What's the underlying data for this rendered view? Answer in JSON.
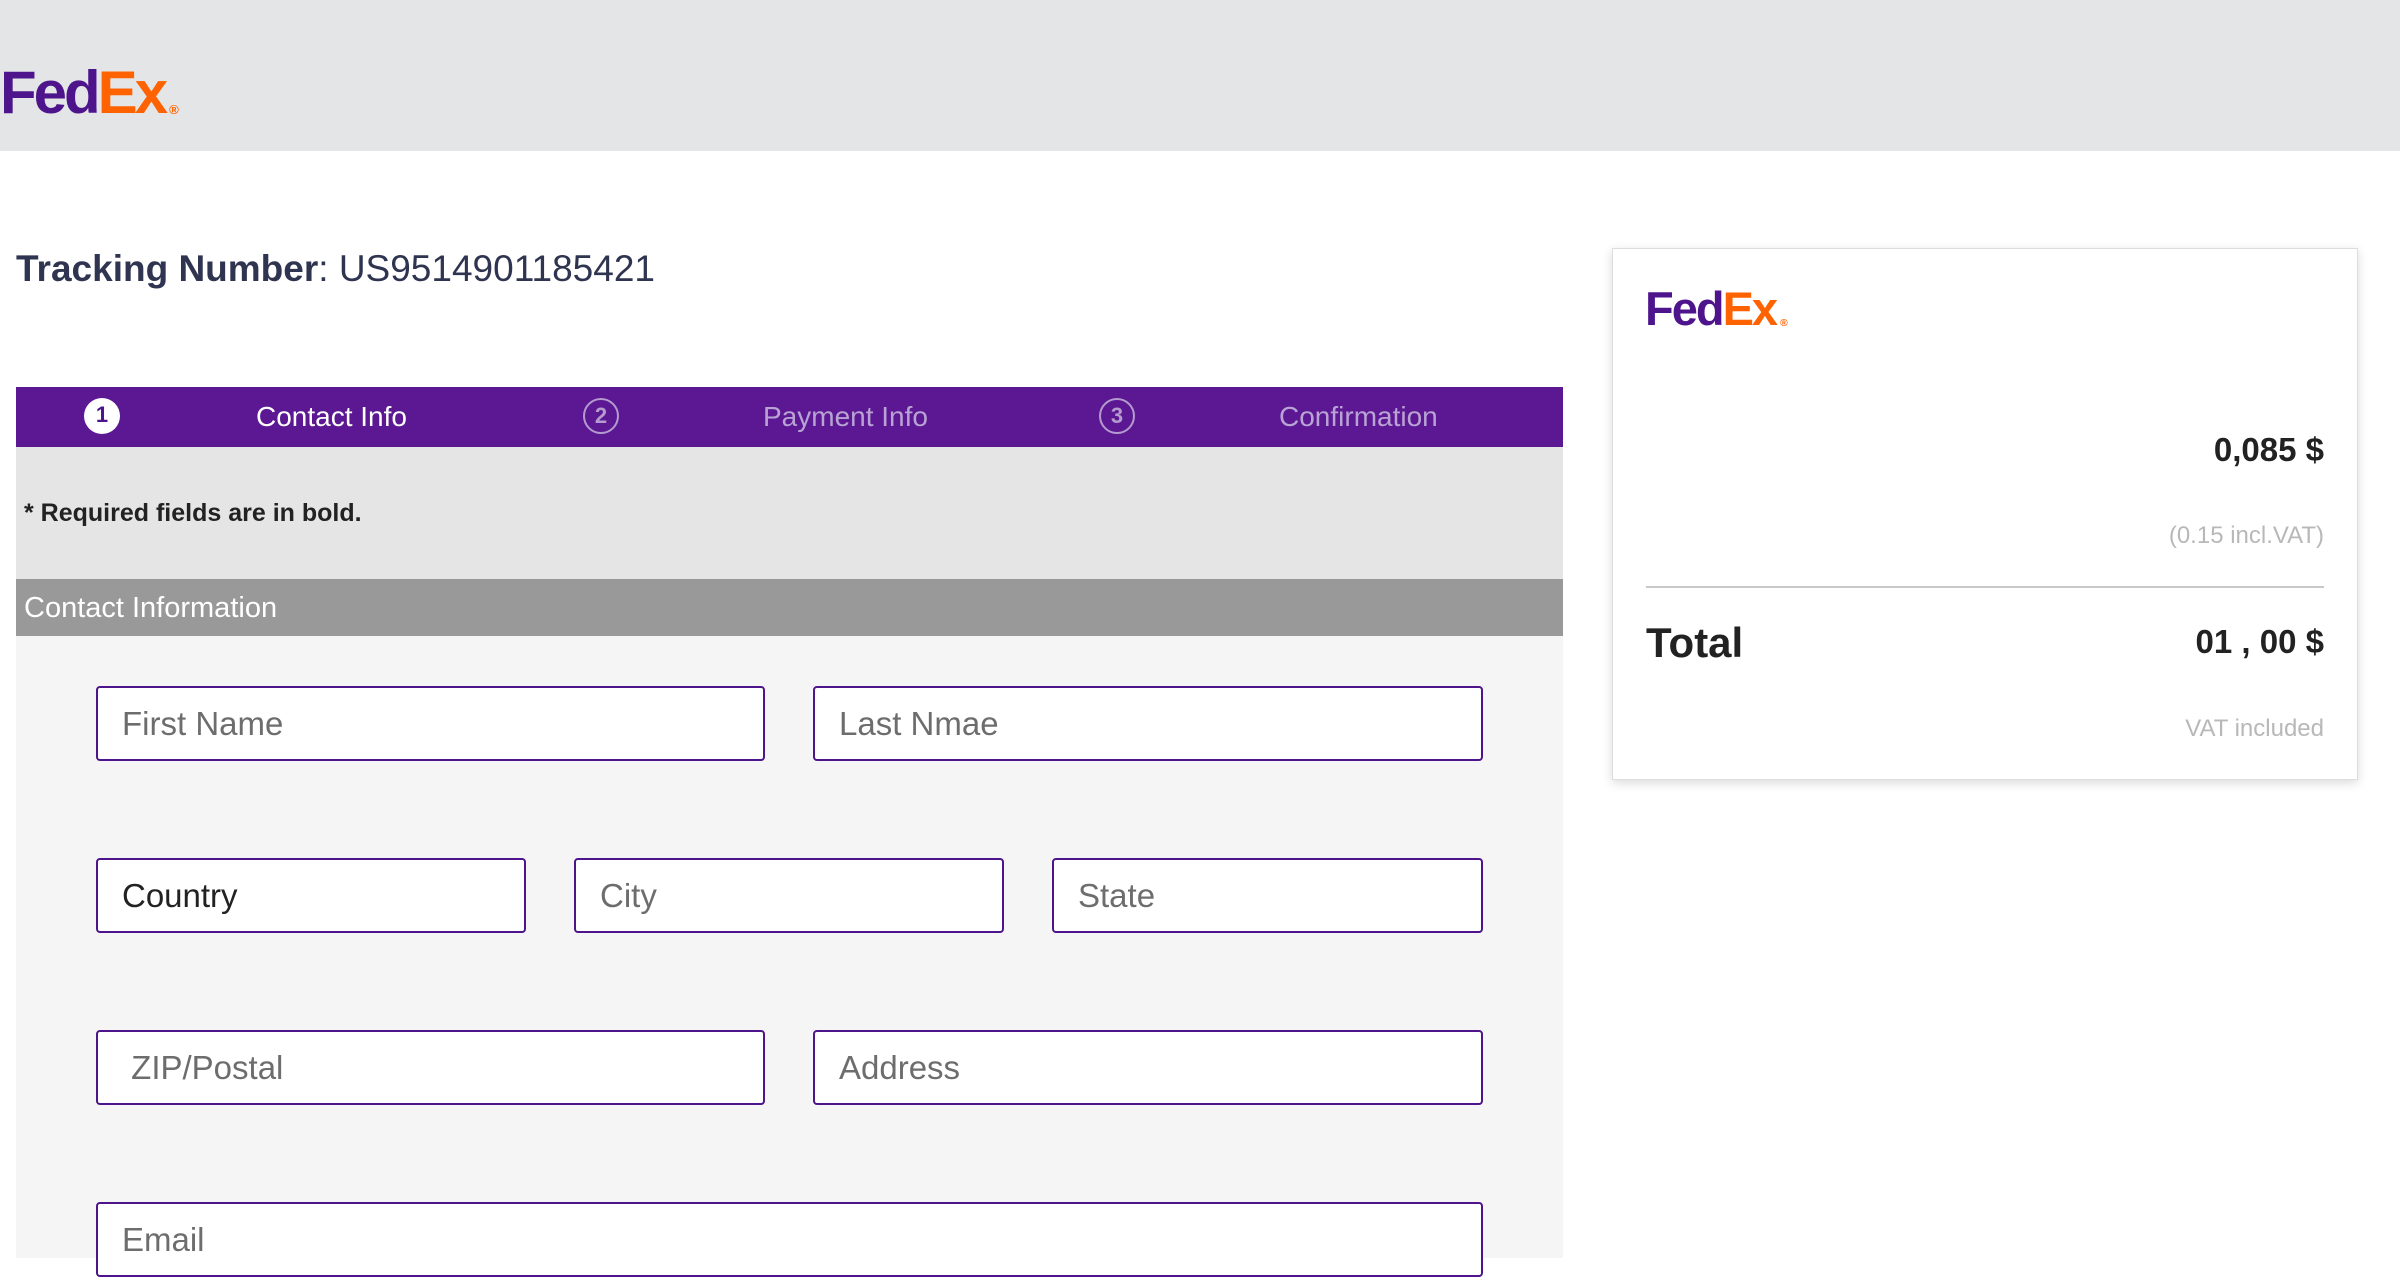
{
  "header": {
    "logo": {
      "fed": "Fed",
      "ex": "Ex",
      "reg": "®"
    }
  },
  "tracking": {
    "label": "Tracking Number",
    "separator": ": ",
    "number": "US9514901185421"
  },
  "steps": [
    {
      "number": "1",
      "label": "Contact Info",
      "active": true
    },
    {
      "number": "2",
      "label": "Payment Info",
      "active": false
    },
    {
      "number": "3",
      "label": "Confirmation",
      "active": false
    }
  ],
  "form": {
    "required_note": "* Required fields are in bold.",
    "section_title": "Contact Information",
    "fields": {
      "first_name": {
        "placeholder": "First Name",
        "value": ""
      },
      "last_name": {
        "placeholder": "Last Nmae",
        "value": ""
      },
      "country": {
        "placeholder": "Country",
        "value": "Country"
      },
      "city": {
        "placeholder": "City",
        "value": ""
      },
      "state": {
        "placeholder": "State",
        "value": ""
      },
      "zip": {
        "placeholder": " ZIP/Postal",
        "value": ""
      },
      "address": {
        "placeholder": "Address",
        "value": ""
      },
      "email": {
        "placeholder": "Email",
        "value": ""
      }
    }
  },
  "summary": {
    "logo": {
      "fed": "Fed",
      "ex": "Ex",
      "reg": "®"
    },
    "price": "0,085 $",
    "vat_note": "(0.15 incl.VAT)",
    "total_label": "Total",
    "total_value": "01 , 00 $",
    "vat_included": "VAT included"
  },
  "colors": {
    "brand_purple": "#4d148c",
    "brand_orange": "#ff6200",
    "step_bar": "#5c1893",
    "header_bg": "#e4e5e7",
    "section_header_bg": "#999999"
  }
}
